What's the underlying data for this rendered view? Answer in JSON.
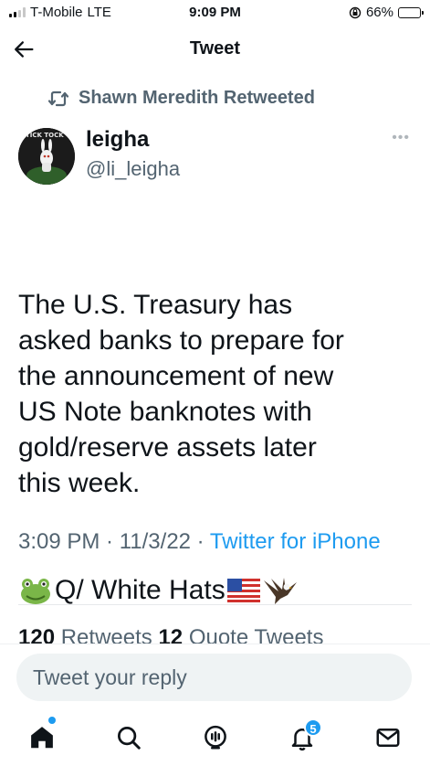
{
  "status_bar": {
    "carrier": "T-Mobile",
    "network": "LTE",
    "time": "9:09 PM",
    "battery": "66%",
    "battery_level": 0.66
  },
  "header": {
    "title": "Tweet",
    "back_icon": "arrow-left-icon"
  },
  "retweet_context": {
    "text": "Shawn Meredith Retweeted",
    "icon": "retweet-icon"
  },
  "author": {
    "name": "leigha",
    "handle": "@li_leigha",
    "avatar_text": "TICK TOCK"
  },
  "tweet": {
    "text": "The U.S. Treasury has\nasked banks to prepare for\nthe announcement of new\nUS Note banknotes with\ngold/reserve assets later\nthis week.",
    "last_line_text": "Q/ White Hats",
    "emojis": [
      "frog",
      "us-flag",
      "eagle"
    ]
  },
  "meta": {
    "time": "3:09 PM",
    "separator1": " · ",
    "date": "11/3/22",
    "separator2": " · ",
    "source": "Twitter for iPhone"
  },
  "stats": {
    "retweets_count": "120",
    "retweets_label": "Retweets",
    "quotes_count": "12",
    "quotes_label": "Quote Tweets"
  },
  "reply": {
    "placeholder": "Tweet your reply"
  },
  "tabbar": {
    "notifications_badge": "5",
    "icons": [
      "home-icon",
      "search-icon",
      "spaces-icon",
      "notifications-icon",
      "messages-icon"
    ]
  },
  "colors": {
    "accent": "#1d9bf0",
    "text": "#0f1419",
    "secondary": "#536471"
  }
}
